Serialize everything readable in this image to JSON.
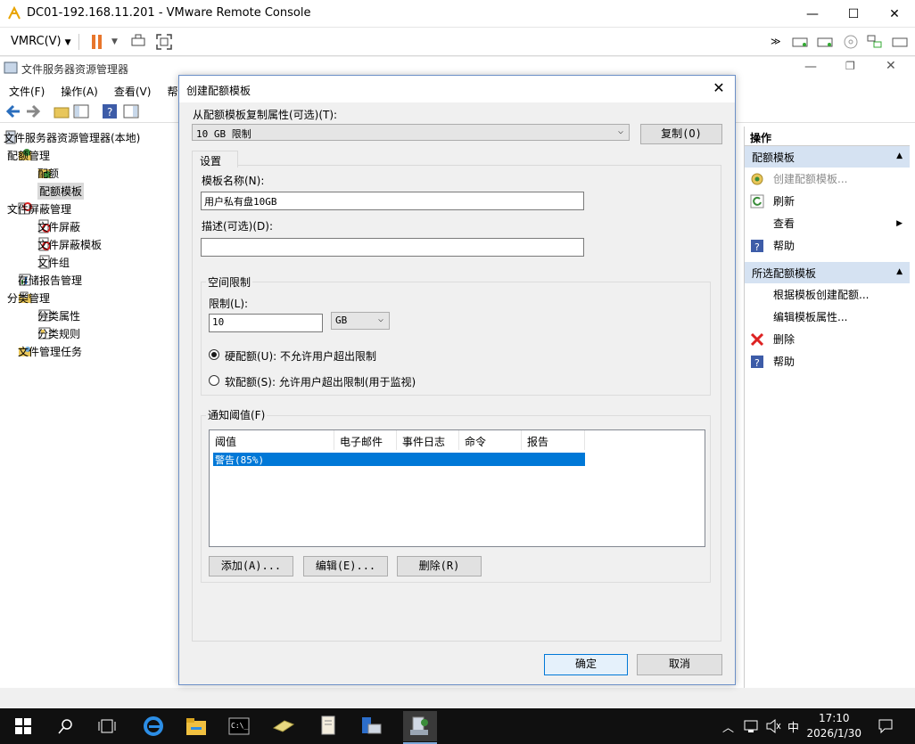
{
  "vmrc": {
    "title": "DC01-192.168.11.201 - VMware Remote Console",
    "menu_label": "VMRC(V)"
  },
  "fsrm": {
    "title": "文件服务器资源管理器",
    "menu": [
      "文件(F)",
      "操作(A)",
      "查看(V)",
      "帮助"
    ],
    "tree": [
      {
        "label": "文件服务器资源管理器(本地)",
        "level": 0,
        "icon": "server-icon"
      },
      {
        "label": "配额管理",
        "level": 1,
        "icon": "quota-mgmt-icon",
        "expanded": true
      },
      {
        "label": "配额",
        "level": 2,
        "icon": "quota-icon"
      },
      {
        "label": "配额模板",
        "level": 2,
        "icon": "quota-template-icon",
        "selected": true
      },
      {
        "label": "文件屏蔽管理",
        "level": 1,
        "icon": "file-screen-mgmt-icon",
        "expanded": true
      },
      {
        "label": "文件屏蔽",
        "level": 2,
        "icon": "file-screen-icon"
      },
      {
        "label": "文件屏蔽模板",
        "level": 2,
        "icon": "file-screen-template-icon"
      },
      {
        "label": "文件组",
        "level": 2,
        "icon": "file-group-icon"
      },
      {
        "label": "存储报告管理",
        "level": 1,
        "icon": "storage-report-icon"
      },
      {
        "label": "分类管理",
        "level": 1,
        "icon": "classification-icon",
        "expanded": true
      },
      {
        "label": "分类属性",
        "level": 2,
        "icon": "class-property-icon"
      },
      {
        "label": "分类规则",
        "level": 2,
        "icon": "class-rule-icon"
      },
      {
        "label": "文件管理任务",
        "level": 1,
        "icon": "file-task-icon"
      }
    ]
  },
  "actions": {
    "header": "操作",
    "section1": {
      "title": "配额模板",
      "items": [
        {
          "label": "创建配额模板...",
          "icon": "create-template-icon",
          "disabled": true
        },
        {
          "label": "刷新",
          "icon": "refresh-icon"
        },
        {
          "label": "查看",
          "icon": "",
          "submenu": true
        },
        {
          "label": "帮助",
          "icon": "help-icon"
        }
      ]
    },
    "section2": {
      "title": "所选配额模板",
      "items": [
        {
          "label": "根据模板创建配额...",
          "icon": ""
        },
        {
          "label": "编辑模板属性...",
          "icon": ""
        },
        {
          "label": "删除",
          "icon": "delete-icon"
        },
        {
          "label": "帮助",
          "icon": "help-icon"
        }
      ]
    }
  },
  "dialog": {
    "title": "创建配额模板",
    "copy_from_label": "从配额模板复制属性(可选)(T):",
    "copy_from_value": "10 GB 限制",
    "copy_button": "复制(O)",
    "tab_label": "设置",
    "template_name_label": "模板名称(N):",
    "template_name_value": "用户私有盘10GB",
    "description_label": "描述(可选)(D):",
    "description_value": "",
    "space_limit_group": "空间限制",
    "limit_label": "限制(L):",
    "limit_value": "10",
    "limit_unit": "GB",
    "hard_quota_label": "硬配额(U): 不允许用户超出限制",
    "soft_quota_label": "软配额(S): 允许用户超出限制(用于监视)",
    "hard_quota_selected": true,
    "threshold_group": "通知阈值(F)",
    "threshold_columns": [
      "阈值",
      "电子邮件",
      "事件日志",
      "命令",
      "报告"
    ],
    "threshold_rows": [
      {
        "threshold": "警告(85%)",
        "email": "",
        "event_log": "",
        "command": "",
        "report": ""
      }
    ],
    "add_button": "添加(A)...",
    "edit_button": "编辑(E)...",
    "delete_button": "删除(R)",
    "ok_button": "确定",
    "cancel_button": "取消"
  },
  "taskbar": {
    "time": "17:10",
    "date": "2026/1/30",
    "ime": "中"
  },
  "colors": {
    "selection": "#0078d7",
    "action_section": "#d5e2f2",
    "taskbar": "#101010",
    "pause": "#e8762c"
  }
}
